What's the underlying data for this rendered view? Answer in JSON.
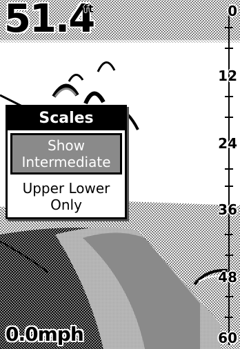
{
  "readout": {
    "depth_value": "51.4",
    "depth_unit": "ft",
    "speed_value": "0.0mph"
  },
  "depth_scale": {
    "labels": [
      "0",
      "12",
      "24",
      "36",
      "48",
      "60"
    ]
  },
  "scales_menu": {
    "title": "Scales",
    "options": [
      {
        "label_line1": "Show",
        "label_line2": "Intermediate",
        "selected": true
      },
      {
        "label_line1": "Upper Lower",
        "label_line2": "Only",
        "selected": false
      }
    ]
  },
  "colors": {
    "foreground": "#000000",
    "background": "#ffffff",
    "selection": "#8a8a8a"
  }
}
